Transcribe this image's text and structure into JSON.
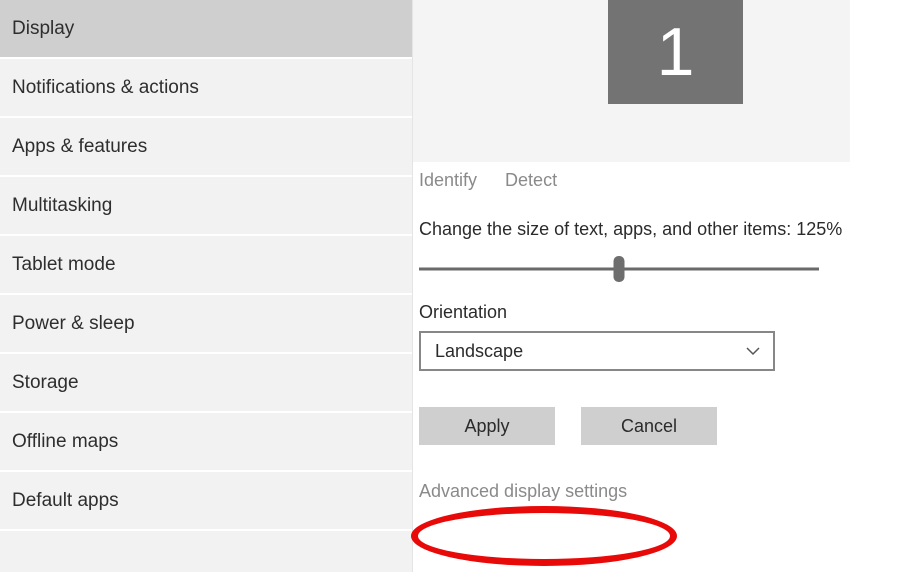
{
  "sidebar": {
    "items": [
      {
        "label": "Display"
      },
      {
        "label": "Notifications & actions"
      },
      {
        "label": "Apps & features"
      },
      {
        "label": "Multitasking"
      },
      {
        "label": "Tablet mode"
      },
      {
        "label": "Power & sleep"
      },
      {
        "label": "Storage"
      },
      {
        "label": "Offline maps"
      },
      {
        "label": "Default apps"
      }
    ],
    "selected_index": 0
  },
  "preview": {
    "monitor_number": "1"
  },
  "links": {
    "identify": "Identify",
    "detect": "Detect"
  },
  "scaling": {
    "label": "Change the size of text, apps, and other items: 125%",
    "value_percent": 125
  },
  "orientation": {
    "label": "Orientation",
    "selected": "Landscape"
  },
  "buttons": {
    "apply": "Apply",
    "cancel": "Cancel"
  },
  "advanced_link": "Advanced display settings"
}
